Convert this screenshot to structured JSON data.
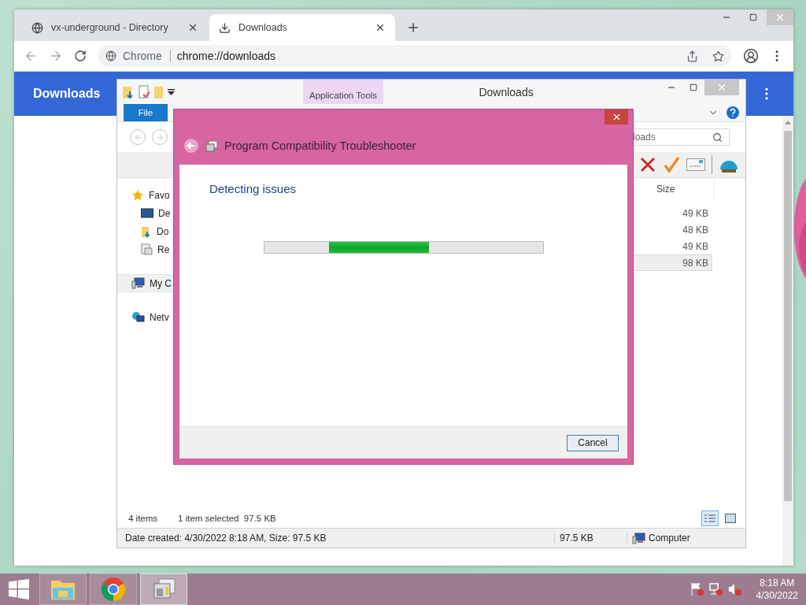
{
  "browser": {
    "tabs": [
      {
        "title": "vx-underground - Directory",
        "kind": "site",
        "selected": false
      },
      {
        "title": "Downloads",
        "kind": "downloads",
        "selected": true
      }
    ],
    "omnibox": {
      "chip": "Chrome",
      "url": "chrome://downloads"
    },
    "page_title": "Downloads"
  },
  "explorer": {
    "title": "Downloads",
    "context_tab": "Application Tools",
    "ribbon_tab": "File",
    "search": "loads",
    "column": "Size",
    "nav_items": [
      {
        "label": "Favo",
        "kind": "star",
        "selected": false,
        "children": [
          {
            "label": "De",
            "kind": "desktop",
            "selected": false
          },
          {
            "label": "Do",
            "kind": "downloads",
            "selected": false
          },
          {
            "label": "Re",
            "kind": "recent",
            "selected": false
          }
        ]
      },
      {
        "label": "My C",
        "kind": "computer",
        "selected": true
      },
      {
        "label": "Netv",
        "kind": "network",
        "selected": false
      }
    ],
    "rows": [
      {
        "size": "49 KB",
        "selected": false
      },
      {
        "size": "48 KB",
        "selected": false
      },
      {
        "size": "49 KB",
        "selected": false
      },
      {
        "size": "98 KB",
        "selected": true
      }
    ],
    "status": {
      "count": "4 items",
      "selection": "1 item selected  97.5 KB"
    },
    "details": {
      "text": "Date created: 4/30/2022 8:18 AM, Size: 97.5 KB",
      "size": "97.5 KB",
      "zone": "Computer"
    }
  },
  "dialog": {
    "title": "Program Compatibility Troubleshooter",
    "heading": "Detecting issues",
    "progress": {
      "indeterminate": true
    },
    "button": "Cancel"
  },
  "taskbar": {
    "apps": [
      {
        "kind": "explorer",
        "active": false
      },
      {
        "kind": "chrome",
        "active": false
      },
      {
        "kind": "troubleshooter",
        "active": true
      }
    ],
    "time": "8:18 AM",
    "date": "4/30/2022"
  }
}
